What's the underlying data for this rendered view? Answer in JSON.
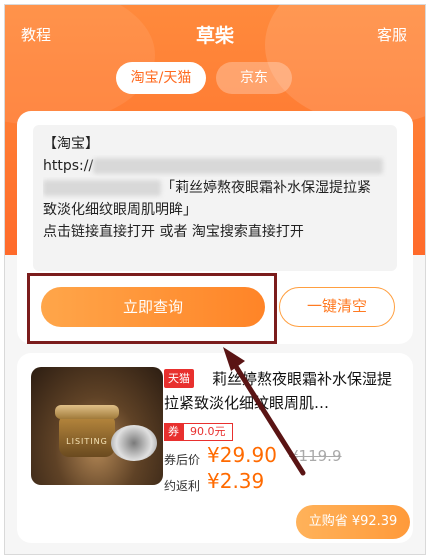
{
  "header": {
    "left_link": "教程",
    "title": "草柴",
    "right_link": "客服",
    "tabs": [
      {
        "label": "淘宝/天猫",
        "active": true
      },
      {
        "label": "京东",
        "active": false
      }
    ]
  },
  "search": {
    "line1": "【淘宝】",
    "line2_prefix": "https://",
    "line3_text": "「莉丝婷熬夜眼霜补水保湿提拉紧",
    "line4": "致淡化细纹眼周肌明眸」",
    "line5": "点击链接直接打开 或者 淘宝搜索直接打开",
    "query_button": "立即查询",
    "clear_button": "一键清空"
  },
  "product": {
    "badge": "天猫",
    "title": "莉丝婷熬夜眼霜补水保湿提拉紧致淡化细纹眼周肌…",
    "image_brand": "LISITING",
    "coupon_label": "券",
    "coupon_value": "90.0元",
    "after_coupon_label": "券后价",
    "after_coupon_price": "¥29.90",
    "original_price": "¥119.9",
    "rebate_label": "约返利",
    "rebate_value": "¥2.39",
    "buy_button": "立购省 ¥92.39"
  },
  "colors": {
    "accent": "#ff7a32",
    "price": "#ff6a00",
    "tmall": "#e8302e",
    "highlight": "#7b1c1c"
  }
}
